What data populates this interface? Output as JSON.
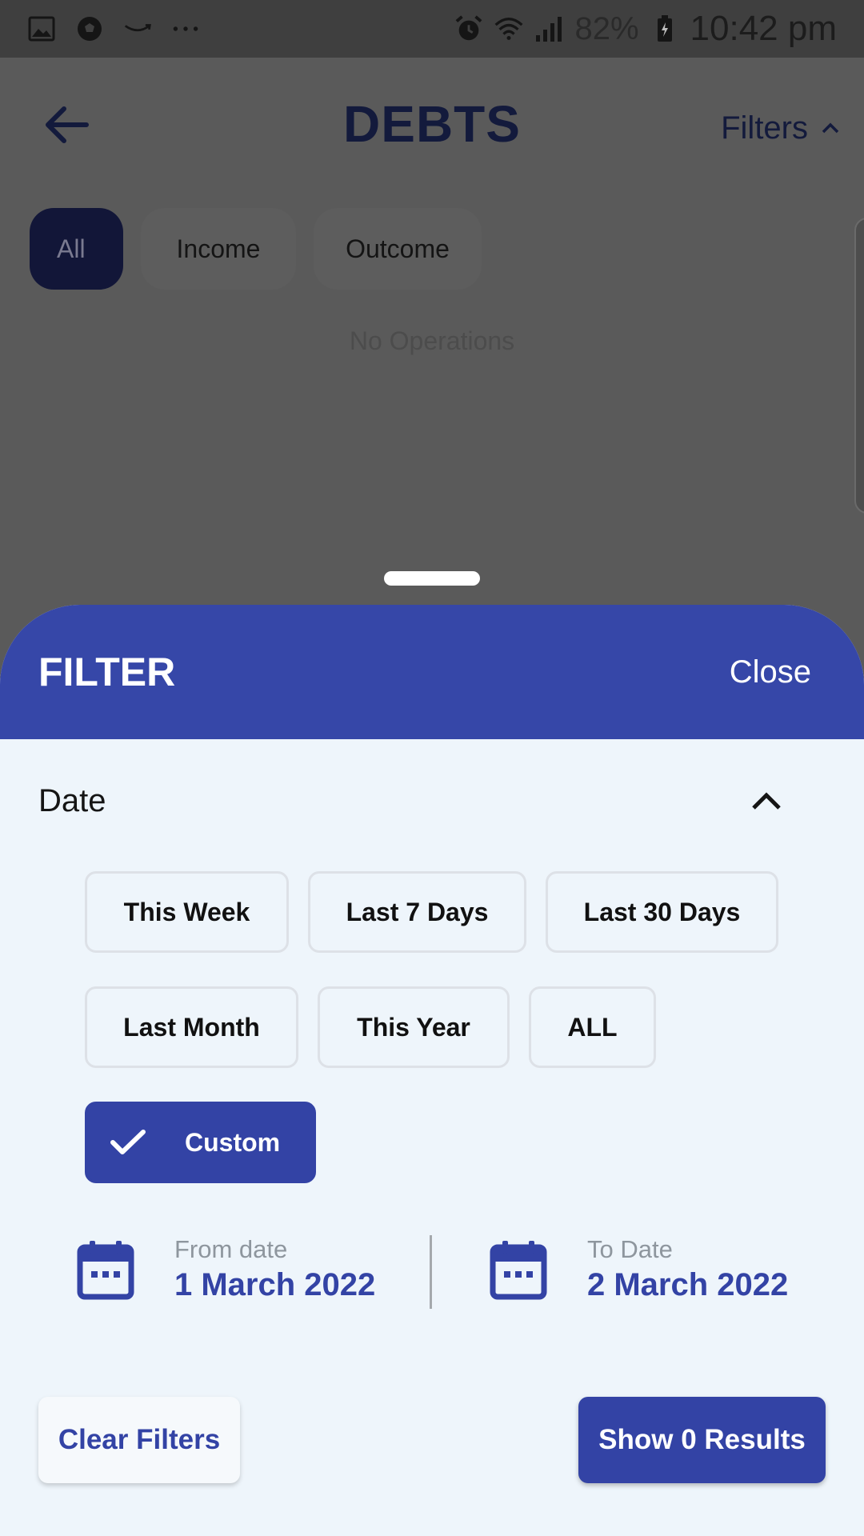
{
  "status_bar": {
    "battery_percent": "82%",
    "time": "10:42 pm",
    "left_icons": [
      "gallery-icon",
      "soccer-ball-icon",
      "amazon-smile-icon",
      "more-dots-icon"
    ],
    "right_icons": [
      "alarm-icon",
      "wifi-icon",
      "signal-icon",
      "battery-charging-icon"
    ]
  },
  "header": {
    "title": "DEBTS",
    "filters_label": "Filters"
  },
  "tabs": [
    {
      "label": "All",
      "active": true
    },
    {
      "label": "Income",
      "active": false
    },
    {
      "label": "Outcome",
      "active": false
    }
  ],
  "empty_state": "No Operations",
  "sheet": {
    "title": "FILTER",
    "close_label": "Close",
    "section_label": "Date",
    "options": [
      {
        "label": "This Week",
        "selected": false
      },
      {
        "label": "Last 7 Days",
        "selected": false
      },
      {
        "label": "Last 30 Days",
        "selected": false
      },
      {
        "label": "Last Month",
        "selected": false
      },
      {
        "label": "This Year",
        "selected": false
      },
      {
        "label": "ALL",
        "selected": false
      },
      {
        "label": "Custom",
        "selected": true
      }
    ],
    "from": {
      "caption": "From date",
      "value": "1 March 2022"
    },
    "to": {
      "caption": "To Date",
      "value": "2 March 2022"
    },
    "clear_label": "Clear Filters",
    "show_label": "Show 0 Results"
  },
  "colors": {
    "primary": "#3647a8",
    "sheet_background": "#eef5fb",
    "title_dark": "#131a3c"
  }
}
